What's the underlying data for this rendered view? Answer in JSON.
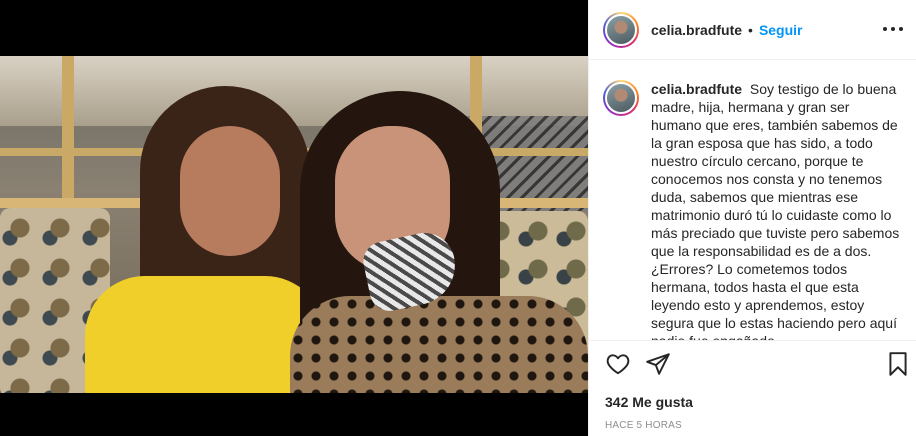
{
  "post": {
    "username": "celia.bradfute",
    "separator": "•",
    "follow_label": "Seguir",
    "caption": "Soy testigo de lo buena madre, hija, hermana y gran ser humano que eres, también sabemos de la gran esposa que has sido, a todo nuestro círculo cercano, porque te conocemos nos consta y no tenemos duda, sabemos que mientras ese matrimonio duró tú lo cuidaste como lo más preciado que tuviste pero sabemos que la responsabilidad es de a dos.",
    "caption_cont": "¿Errores? Lo cometemos todos hermana, todos hasta el que esta leyendo esto y aprendemos, estoy segura que lo estas haciendo pero aquí nadie fue engañado",
    "likes": "342 Me gusta",
    "time": "HACE 5 HORAS"
  },
  "icons": {
    "more": "more-options-icon",
    "like": "heart-icon",
    "share": "paper-plane-icon",
    "save": "bookmark-icon"
  },
  "colors": {
    "follow": "#0095f6",
    "text": "#262626",
    "muted": "#8e8e8e",
    "border": "#efefef"
  }
}
